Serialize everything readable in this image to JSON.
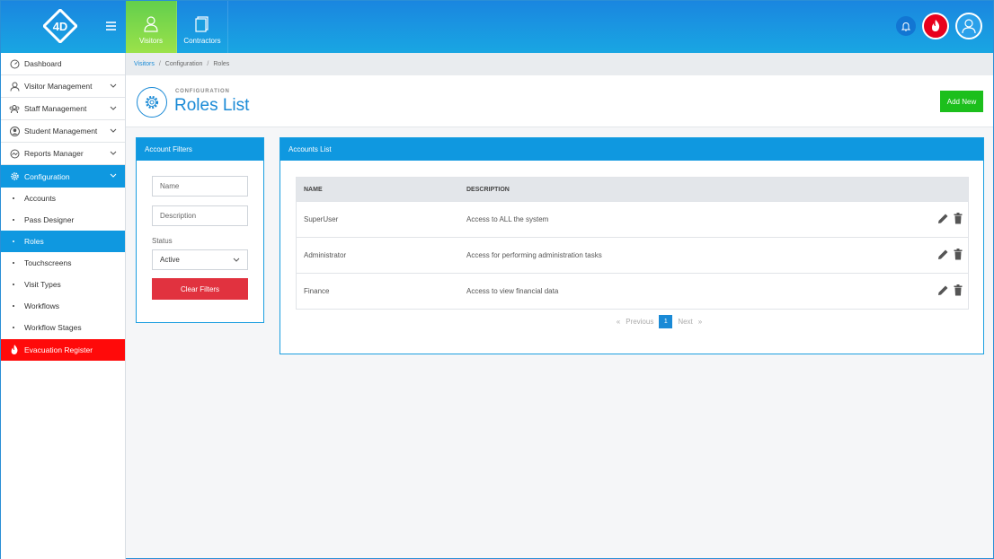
{
  "topnav": [
    {
      "label": "Visitors",
      "active": true,
      "icon": "user-icon"
    },
    {
      "label": "Contractors",
      "active": false,
      "icon": "document-icon"
    }
  ],
  "logo": {
    "text": "4D"
  },
  "sidebar": {
    "items": [
      {
        "label": "Dashboard",
        "icon": "dashboard-icon"
      },
      {
        "label": "Visitor Management",
        "icon": "person-icon"
      },
      {
        "label": "Staff Management",
        "icon": "group-icon"
      },
      {
        "label": "Student Management",
        "icon": "student-icon"
      },
      {
        "label": "Reports Manager",
        "icon": "report-icon"
      },
      {
        "label": "Configuration",
        "icon": "gear-icon"
      }
    ],
    "config_sub": [
      {
        "label": "Accounts"
      },
      {
        "label": "Pass Designer"
      },
      {
        "label": "Roles"
      },
      {
        "label": "Touchscreens"
      },
      {
        "label": "Visit Types"
      },
      {
        "label": "Workflows"
      },
      {
        "label": "Workflow Stages"
      }
    ],
    "evacuation": "Evacuation Register"
  },
  "breadcrumb": {
    "items": [
      "Visitors",
      "Configuration",
      "Roles"
    ],
    "sep": "/"
  },
  "header": {
    "subtitle": "CONFIGURATION",
    "title": "Roles List",
    "add_label": "Add New"
  },
  "filters": {
    "title": "Account Filters",
    "name_placeholder": "Name",
    "description_placeholder": "Description",
    "status_label": "Status",
    "status_value": "Active",
    "clear_label": "Clear Filters"
  },
  "accounts": {
    "title": "Accounts List",
    "columns": [
      "NAME",
      "DESCRIPTION"
    ],
    "rows": [
      {
        "name": "SuperUser",
        "description": "Access to ALL the system"
      },
      {
        "name": "Administrator",
        "description": "Access for performing administration tasks"
      },
      {
        "name": "Finance",
        "description": "Access to view financial data"
      }
    ],
    "pager": {
      "prev": "«",
      "prev_label": "Previous",
      "page": "1",
      "next_label": "Next",
      "next": "»"
    }
  },
  "colors": {
    "primary": "#0f98e0",
    "green": "#1cbf1c",
    "red": "#e1323f",
    "evac": "#ff0a0a"
  }
}
